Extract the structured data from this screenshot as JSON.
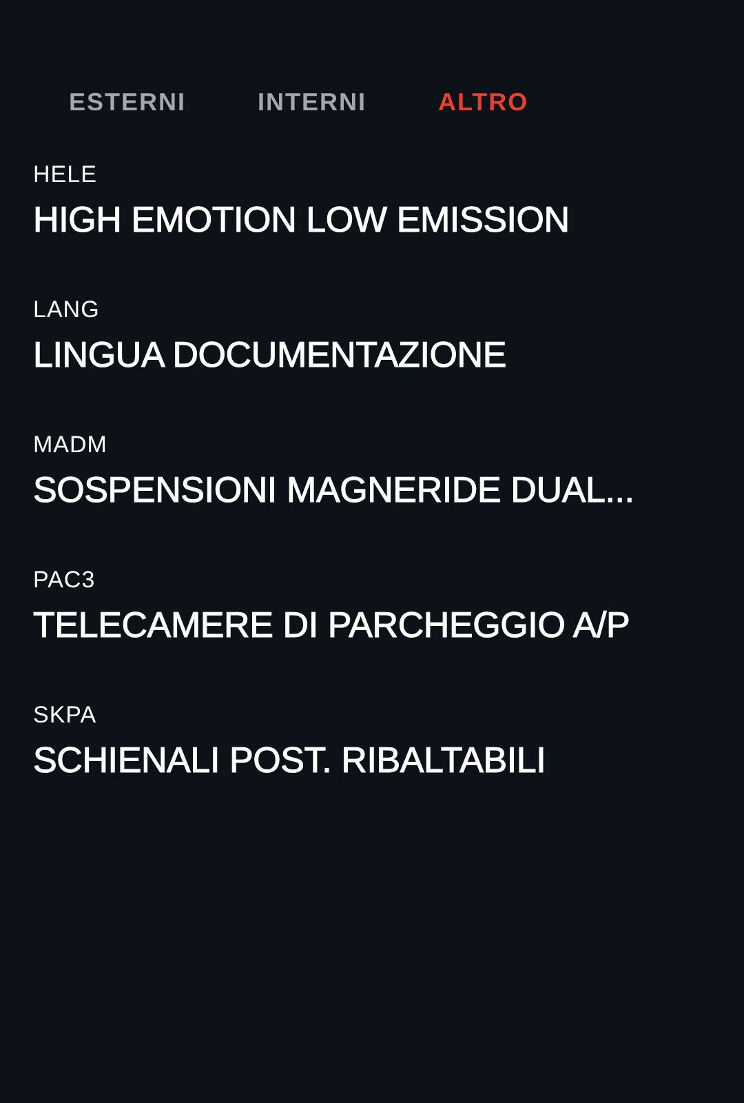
{
  "tabs": [
    {
      "label": "ESTERNI",
      "selected": false
    },
    {
      "label": "INTERNI",
      "selected": false
    },
    {
      "label": "ALTRO",
      "selected": true
    }
  ],
  "options": [
    {
      "code": "HELE",
      "title": "HIGH EMOTION LOW EMISSION"
    },
    {
      "code": "LANG",
      "title": "LINGUA DOCUMENTAZIONE"
    },
    {
      "code": "MADM",
      "title": "SOSPENSIONI MAGNERIDE DUAL..."
    },
    {
      "code": "PAC3",
      "title": "TELECAMERE DI PARCHEGGIO A/P"
    },
    {
      "code": "SKPA",
      "title": "SCHIENALI POST. RIBALTABILI"
    }
  ]
}
